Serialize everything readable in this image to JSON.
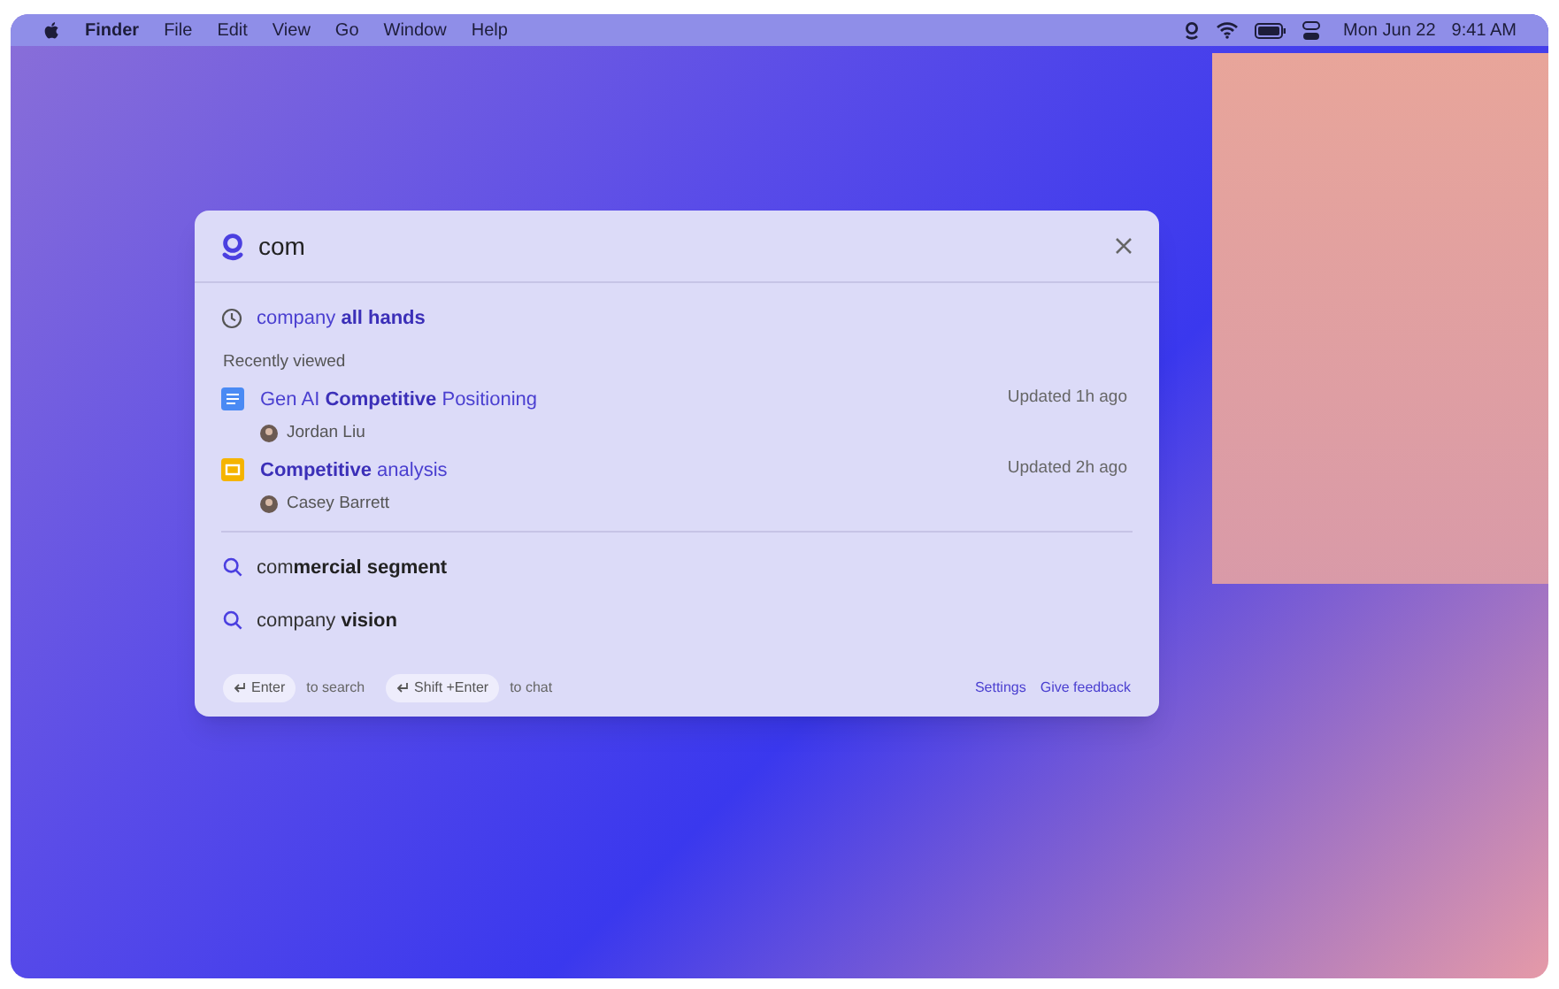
{
  "menu_bar": {
    "items": [
      {
        "label": "Finder",
        "kind": "app"
      },
      {
        "label": "File",
        "kind": "menu"
      },
      {
        "label": "Edit",
        "kind": "menu"
      },
      {
        "label": "View",
        "kind": "menu"
      },
      {
        "label": "Go",
        "kind": "menu"
      },
      {
        "label": "Window",
        "kind": "menu"
      },
      {
        "label": "Help",
        "kind": "menu"
      }
    ],
    "date": "Mon Jun 22",
    "time": "9:41 AM"
  },
  "search": {
    "value": "com"
  },
  "recent_query": "company **all hands**",
  "section_title": "Recently viewed",
  "documents": [
    {
      "title": "Gen AI **Competitive** Positioning",
      "owner": "Jordan Liu",
      "updated": "Updated 1h ago",
      "kind": "doc"
    },
    {
      "title": "**Competitive** analysis",
      "owner": "Casey Barrett",
      "updated": "Updated 2h ago",
      "kind": "slides"
    }
  ],
  "suggestions": [
    "com**mercial segment**",
    "company **vision**"
  ],
  "shortcuts": [
    {
      "key": "Enter",
      "hint": "to search"
    },
    {
      "key": "Shift +Enter",
      "hint": "to chat"
    }
  ],
  "links": [
    "Settings",
    "Give feedback"
  ]
}
